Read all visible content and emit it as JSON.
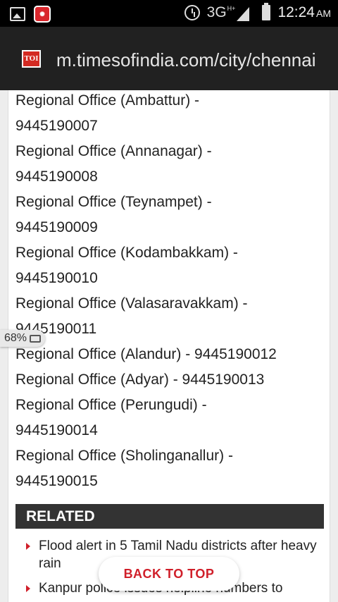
{
  "status_bar": {
    "network": "3G",
    "network_sup": "H+",
    "time": "12:24",
    "ampm": "AM",
    "icons": [
      "gallery-icon",
      "app-notification-icon",
      "alarm-icon",
      "signal-icon",
      "battery-icon"
    ]
  },
  "browser": {
    "logo_text": "TOI",
    "url": "m.timesofindia.com/city/chennai"
  },
  "article": {
    "lines": [
      "Regional Office (Ambattur) -",
      "9445190007",
      "Regional Office (Annanagar) -",
      "9445190008",
      "Regional Office (Teynampet) -",
      "9445190009",
      "Regional Office (Kodambakkam) -",
      "9445190010",
      "Regional Office (Valasaravakkam) -",
      "9445190011",
      "Regional Office (Alandur) - 9445190012",
      "Regional Office (Adyar) - 9445190013",
      "Regional Office (Perungudi) -",
      "9445190014",
      "Regional Office (Sholinganallur) -",
      "9445190015"
    ]
  },
  "related": {
    "heading": "RELATED",
    "items": [
      "Flood alert in 5 Tamil Nadu districts after heavy rain",
      "Kanpur police issues helpline numbers to"
    ]
  },
  "zoom": {
    "label": "68%"
  },
  "back_to_top": {
    "label": "BACK TO TOP"
  },
  "colors": {
    "accent_red": "#d01f2a",
    "related_bar": "#333333",
    "url_bar": "#212121"
  }
}
